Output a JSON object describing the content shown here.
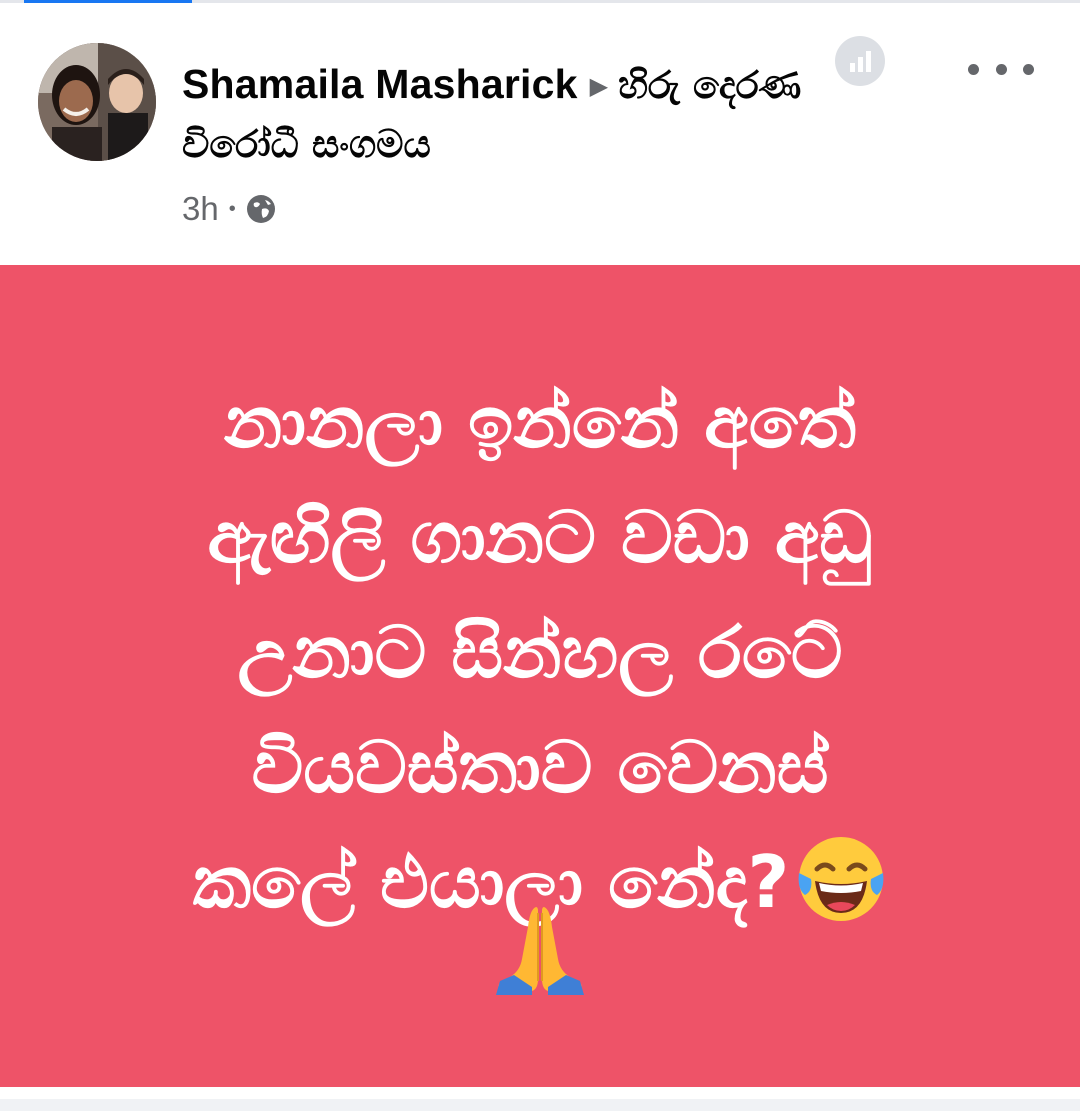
{
  "post": {
    "author_name": "Shamaila Masharick",
    "arrow": "▶",
    "group_name": "හිරු දෙරණ විරෝධී සංගමය",
    "timestamp": "3h",
    "separator": "•",
    "privacy_icon": "globe-icon",
    "insights_icon": "bar-chart-icon",
    "more_icon": "ellipsis-icon",
    "body_text": "නානලා ඉන්නේ අතේ\nඇඟිලි ගානට වඩා අඩු\nඋනාට සින්හල රටේ\nවියවස්තාව වෙනස්\nකලේ එයාලා නේද?",
    "body_emojis": [
      "face-with-tears-of-joy-emoji",
      "folded-hands-emoji"
    ],
    "background_color": "#ee5368",
    "text_color": "#ffffff"
  }
}
